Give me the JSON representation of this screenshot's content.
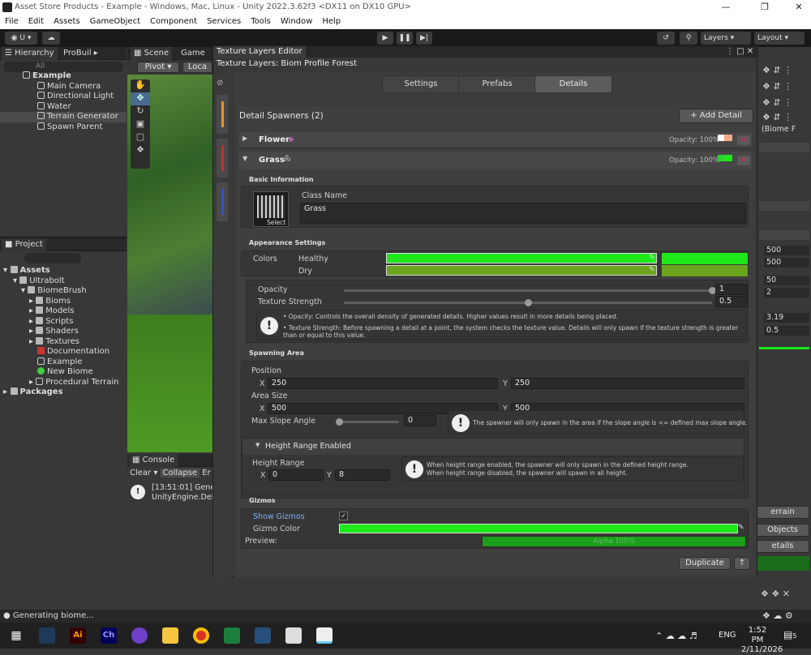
{
  "window": {
    "title": "Asset Store Products - Example - Windows, Mac, Linux - Unity 2022.3.62f3 <DX11 on DX10 GPU>"
  },
  "menu": [
    "File",
    "Edit",
    "Assets",
    "GameObject",
    "Component",
    "Services",
    "Tools",
    "Window",
    "Help"
  ],
  "toolbar": {
    "account": "U",
    "layers": "Layers",
    "layout": "Layout"
  },
  "hierarchy": {
    "tab": "Hierarchy",
    "tab2": "ProBuil",
    "search_placeholder": "All",
    "root": "Example",
    "items": [
      "Main Camera",
      "Directional Light",
      "Water",
      "Terrain Generator",
      "Spawn Parent"
    ]
  },
  "project": {
    "tab": "Project",
    "assets": "Assets",
    "tree": [
      "Ultrabolt",
      "BiomeBrush",
      "Bioms",
      "Models",
      "Scripts",
      "Shaders",
      "Textures",
      "Documentation",
      "Example",
      "New Biome",
      "Procedural Terrain"
    ],
    "packages": "Packages"
  },
  "scene": {
    "tab": "Scene",
    "game_tab": "Game",
    "pivot": "Pivot",
    "local": "Loca"
  },
  "console": {
    "tab": "Console",
    "clear": "Clear",
    "collapse": "Collapse",
    "errors": "Er",
    "log1": "[13:51:01] Gener",
    "log2": "UnityEngine.Deb"
  },
  "editor": {
    "window_tab": "Texture Layers Editor",
    "title": "Texture Layers: Biom Profile Forest",
    "tabs": [
      "Settings",
      "Prefabs",
      "Details"
    ],
    "spawners_title": "Detail Spawners (2)",
    "add_detail": "+ Add Detail",
    "flower": {
      "name": "Flower",
      "opacity": "Opacity: 100%"
    },
    "grass": {
      "name": "Grass",
      "opacity": "Opacity: 100%"
    },
    "basic_info": "Basic Information",
    "class_name_label": "Class Name",
    "class_name_value": "Grass",
    "select": "Select",
    "appearance": "Appearance Settings",
    "colors": "Colors",
    "healthy": "Healthy",
    "dry": "Dry",
    "opacity_label": "Opacity",
    "opacity_value": "1",
    "opacity_level": 1.0,
    "texture_strength_label": "Texture Strength",
    "texture_strength_value": "0.5",
    "texture_strength_level": 0.5,
    "info_opacity": "• Opacity: Controls the overall density of generated details. Higher values result in more details being placed.",
    "info_texture": "• Texture Strength: Before spawning a detail at a point, the system checks the texture value. Details will only spawn if the texture strength is greater than or equal to this value.",
    "spawning_area": "Spawning Area",
    "position": "Position",
    "pos_x": "250",
    "pos_y": "250",
    "area_size": "Area Size",
    "size_x": "500",
    "size_y": "500",
    "max_slope": "Max Slope Angle",
    "max_slope_value": "0",
    "max_slope_level": 0.0,
    "slope_info": "The spawner will only spawn in the area if the slope angle is <= defined max slope angle.",
    "height_range_enabled": "Height Range Enabled",
    "height_range": "Height Range",
    "hr_x": "0",
    "hr_y": "8",
    "height_info1": "When height range enabled, the spawner will only spawn in the defined height range.",
    "height_info2": "When height range disabled, the spawner will spawn in all height.",
    "gizmos": "Gizmos",
    "show_gizmos": "Show Gizmos",
    "gizmo_color": "Gizmo Color",
    "preview": "Preview:",
    "preview_text": "Alpha 100%",
    "duplicate": "Duplicate",
    "x": "X",
    "y": "Y"
  },
  "inspector": {
    "biome_label": "(Biome F",
    "v1": "500",
    "v2": "500",
    "v3": "50",
    "v4": "2",
    "v5": "3.19",
    "v6": "0.5",
    "btn1": "errain",
    "btn2": "Objects",
    "btn3": "etails"
  },
  "status": {
    "text": "Generating biome..."
  },
  "taskbar": {
    "lang": "ENG",
    "time": "1:52 PM",
    "date": "2/11/2026",
    "notif": "5"
  },
  "colors": {
    "healthy": "#1ee81a",
    "dry": "#6aa51d",
    "gizmo": "#1ee81a",
    "accent_orange": "#f0960f",
    "accent_red": "#d8262a",
    "accent_blue": "#2a52e0",
    "flower_swatch": "#f2a788"
  }
}
